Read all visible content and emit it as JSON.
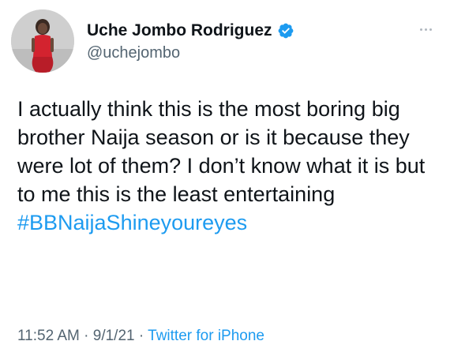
{
  "author": {
    "display_name": "Uche Jombo Rodriguez",
    "handle": "@uchejombo",
    "verified": true,
    "avatar_icon": "profile-photo-avatar"
  },
  "tweet": {
    "text": "I actually think this is the most boring big brother Naija season or is it because they were lot of them? I don’t know what it is but to me this is the least entertaining",
    "hashtag": "#BBNaijaShineyoureyes",
    "time": "11:52 AM",
    "separator": " · ",
    "date": "9/1/21",
    "source": "Twitter for iPhone"
  },
  "icons": {
    "verified": "verified-badge-icon",
    "more": "more-options-icon"
  },
  "colors": {
    "link_blue": "#1d9bf0",
    "text": "#0f1419",
    "muted": "#536471"
  }
}
